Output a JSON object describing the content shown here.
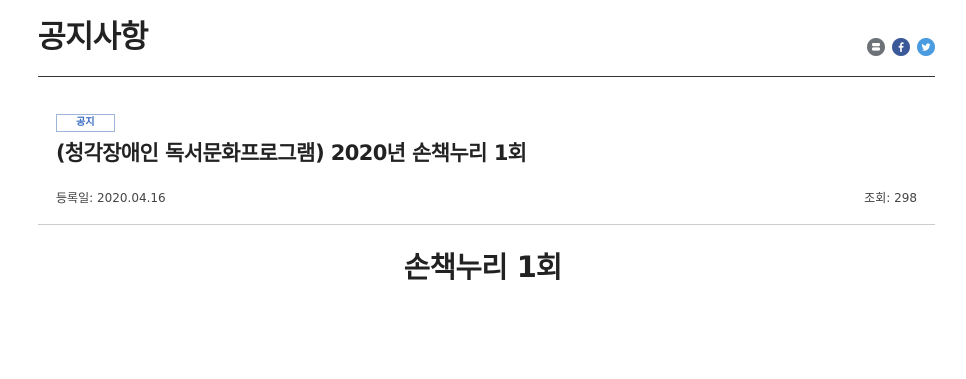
{
  "page": {
    "title": "공지사항"
  },
  "share": {
    "buttons": [
      {
        "icon": "profile-share-icon",
        "color": "#6d7278"
      },
      {
        "icon": "facebook-icon",
        "color": "#3b5998"
      },
      {
        "icon": "twitter-icon",
        "color": "#4a9be0"
      }
    ]
  },
  "post": {
    "badge": "공지",
    "title": "(청각장애인 독서문화프로그램) 2020년 손책누리 1회",
    "date_label": "등록일: 2020.04.16",
    "views_label": "조회: 298"
  },
  "content": {
    "heading": "손책누리 1회"
  },
  "colors": {
    "badge_text": "#3b6cc4",
    "badge_border": "#9fb6db",
    "rule_dark": "#333333",
    "rule_light": "#cccccc"
  }
}
